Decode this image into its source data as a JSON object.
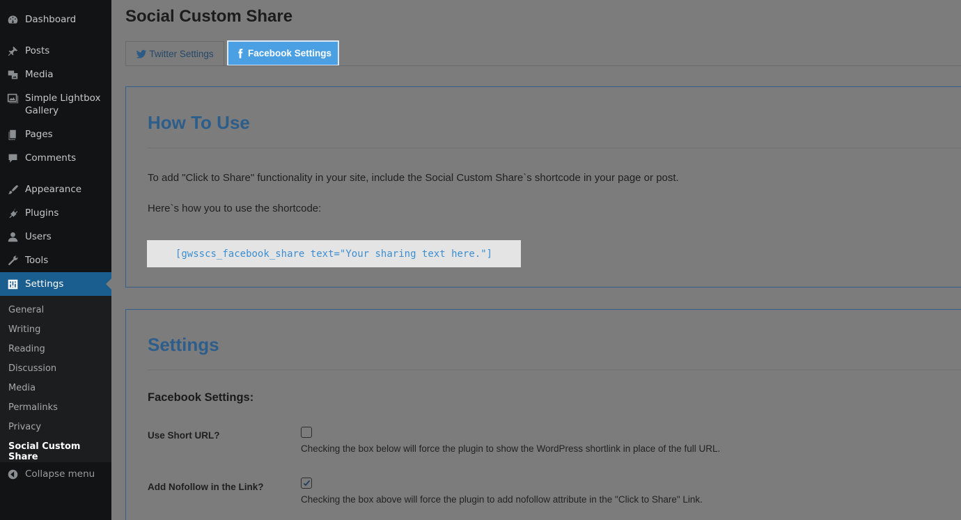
{
  "sidebar": {
    "items": [
      {
        "label": "Dashboard",
        "icon": "dashboard-icon"
      },
      {
        "label": "Posts",
        "icon": "pin-icon"
      },
      {
        "label": "Media",
        "icon": "media-icon"
      },
      {
        "label": "Simple Lightbox Gallery",
        "icon": "gallery-icon"
      },
      {
        "label": "Pages",
        "icon": "pages-icon"
      },
      {
        "label": "Comments",
        "icon": "comments-icon"
      },
      {
        "label": "Appearance",
        "icon": "brush-icon"
      },
      {
        "label": "Plugins",
        "icon": "plugin-icon"
      },
      {
        "label": "Users",
        "icon": "user-icon"
      },
      {
        "label": "Tools",
        "icon": "wrench-icon"
      },
      {
        "label": "Settings",
        "icon": "settings-icon"
      }
    ],
    "submenu": [
      "General",
      "Writing",
      "Reading",
      "Discussion",
      "Media",
      "Permalinks",
      "Privacy",
      "Social Custom Share"
    ],
    "collapse_label": "Collapse menu"
  },
  "page": {
    "title": "Social Custom Share",
    "tabs": {
      "twitter": "Twitter Settings",
      "facebook": "Facebook Settings"
    }
  },
  "howto": {
    "title": "How To Use",
    "intro": "To add \"Click to Share\" functionality in your site, include the Social Custom Share`s shortcode in your page or post.",
    "usage": "Here`s how you to use the shortcode:",
    "shortcode": "[gwsscs_facebook_share text=\"Your sharing text here.\"]"
  },
  "settings": {
    "title": "Settings",
    "section": "Facebook Settings:",
    "fields": [
      {
        "label": "Use Short URL?",
        "checked": false,
        "desc": "Checking the box below will force the plugin to show the WordPress shortlink in place of the full URL."
      },
      {
        "label": "Add Nofollow in the Link?",
        "checked": true,
        "desc": "Checking the box above will force the plugin to add nofollow attribute in the \"Click to Share\" Link."
      }
    ]
  },
  "colors": {
    "accent": "#4aa0e3",
    "sidebar": "#111314",
    "active": "#1a5d8f"
  }
}
